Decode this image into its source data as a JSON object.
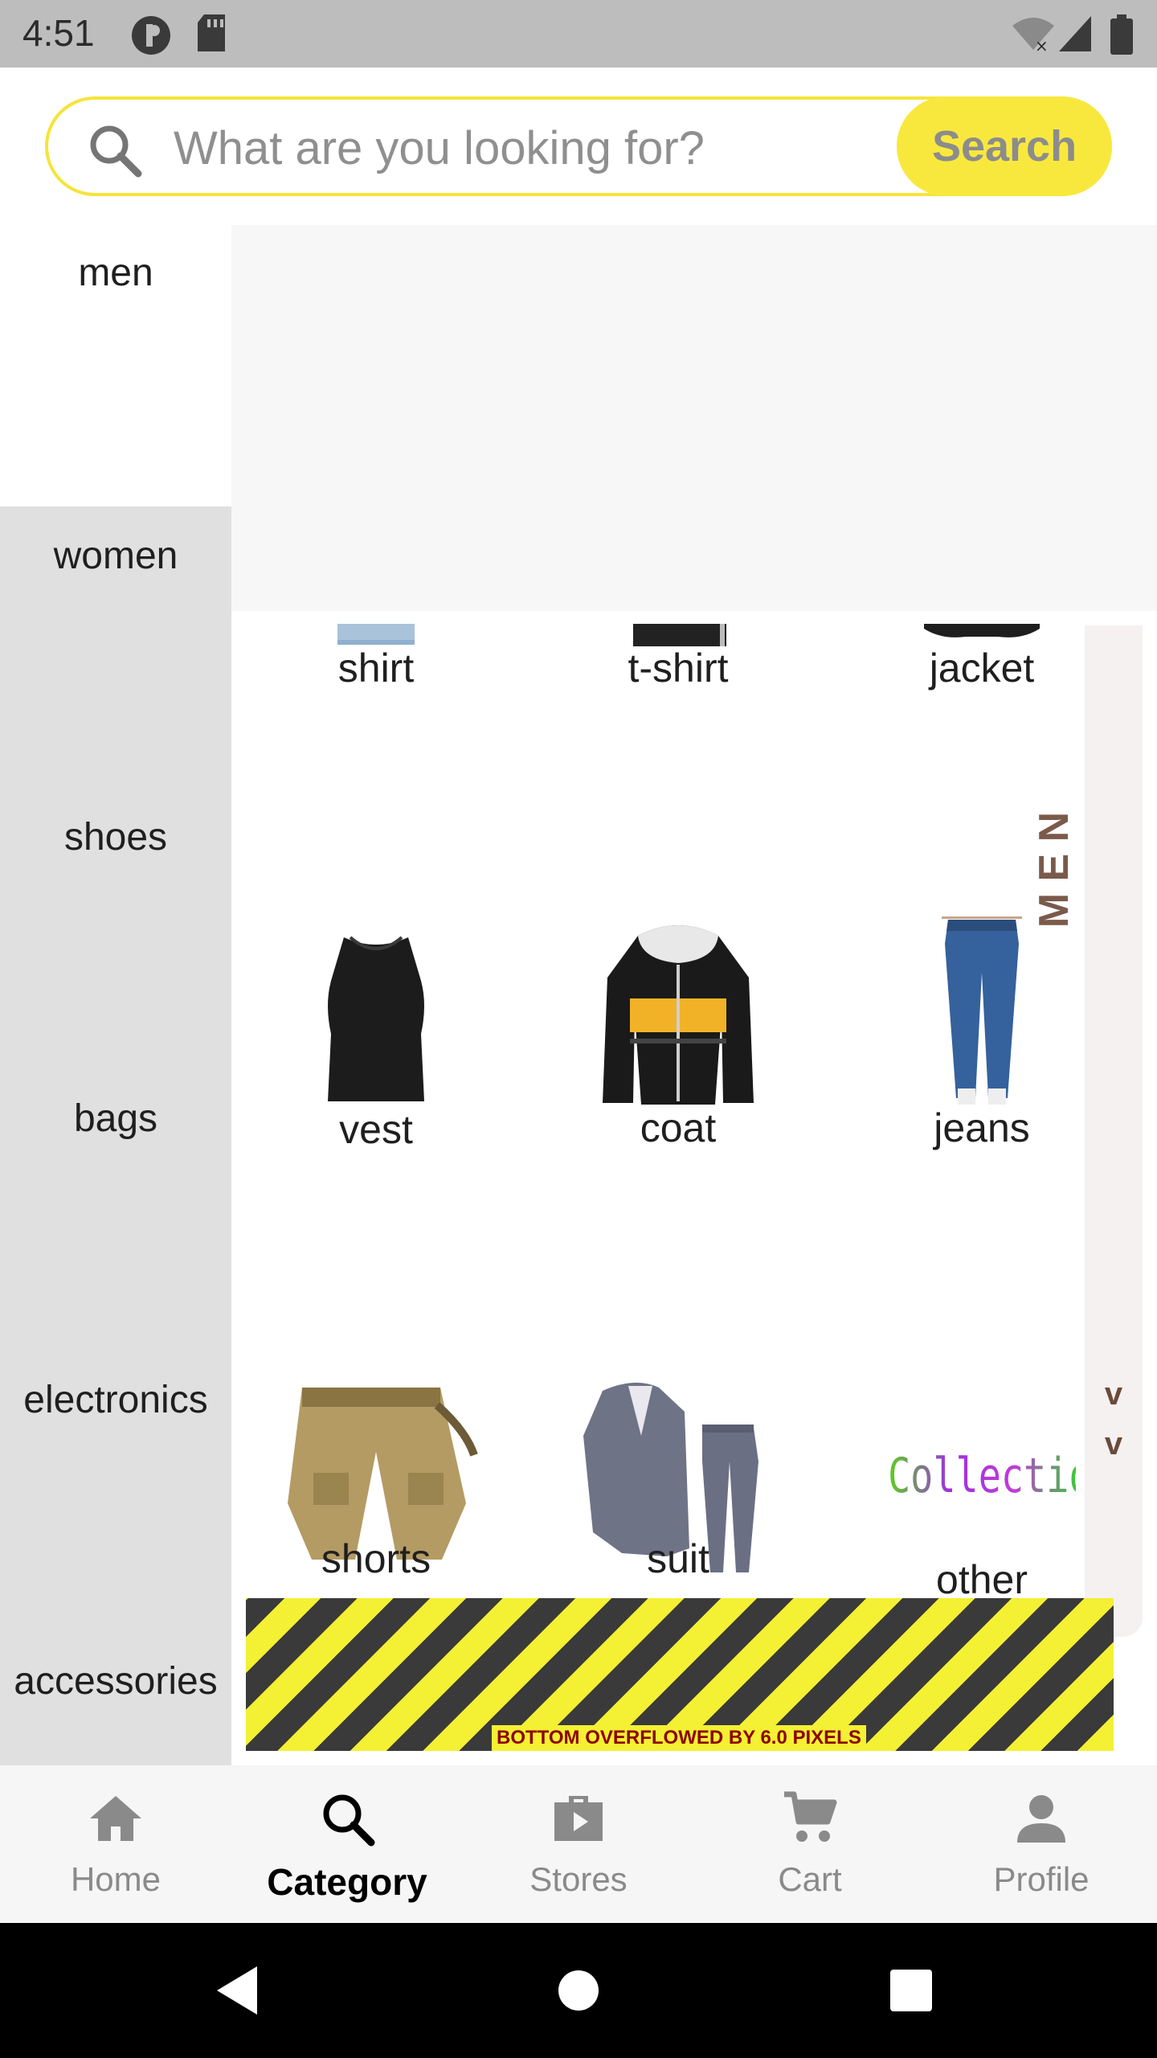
{
  "status_bar": {
    "time": "4:51"
  },
  "search": {
    "placeholder": "What are you looking for?",
    "button_label": "Search"
  },
  "sidebar": {
    "items": [
      {
        "label": "men",
        "active": true
      },
      {
        "label": "women",
        "active": false
      },
      {
        "label": "shoes",
        "active": false
      },
      {
        "label": "bags",
        "active": false
      },
      {
        "label": "electronics",
        "active": false
      },
      {
        "label": "accessories",
        "active": false
      }
    ]
  },
  "grid": {
    "items": [
      {
        "label": "shirt"
      },
      {
        "label": "t-shirt"
      },
      {
        "label": "jacket"
      },
      {
        "label": "vest"
      },
      {
        "label": "coat"
      },
      {
        "label": "jeans"
      },
      {
        "label": "shorts"
      },
      {
        "label": "suit"
      },
      {
        "label": "other"
      }
    ],
    "other_image_text": "Collection"
  },
  "rail": {
    "text": "M E N",
    "chevrons": [
      "v",
      "v"
    ]
  },
  "overflow_warning": "BOTTOM OVERFLOWED BY 6.0 PIXELS",
  "bottom_nav": {
    "items": [
      {
        "label": "Home",
        "icon": "home-icon"
      },
      {
        "label": "Category",
        "icon": "search-icon",
        "active": true
      },
      {
        "label": "Stores",
        "icon": "store-bag-icon"
      },
      {
        "label": "Cart",
        "icon": "cart-icon"
      },
      {
        "label": "Profile",
        "icon": "person-icon"
      }
    ]
  },
  "colors": {
    "accent": "#f8e83e",
    "rail_text": "#7a5a4a",
    "sidebar_bg": "#e0e0e0"
  }
}
